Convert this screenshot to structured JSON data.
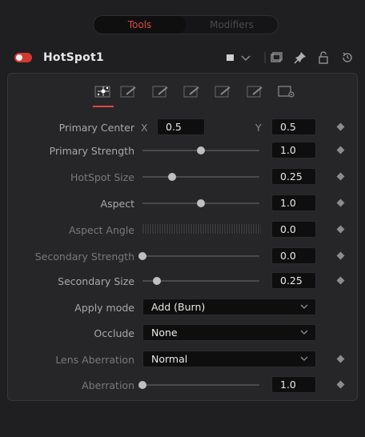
{
  "tabs": {
    "tools": "Tools",
    "modifiers": "Modifiers"
  },
  "tool": {
    "name": "HotSpot1"
  },
  "header_icons": [
    "color-swatch-icon",
    "chevron-down-icon",
    "window-icon",
    "pin-icon",
    "lock-icon",
    "reset-icon"
  ],
  "controls": {
    "primary_center": {
      "label": "Primary Center",
      "x_label": "X",
      "x_value": "0.5",
      "y_label": "Y",
      "y_value": "0.5"
    },
    "primary_strength": {
      "label": "Primary Strength",
      "value": "1.0",
      "slider_fraction": 0.5
    },
    "hotspot_size": {
      "label": "HotSpot Size",
      "value": "0.25",
      "slider_fraction": 0.25
    },
    "aspect": {
      "label": "Aspect",
      "value": "1.0",
      "slider_fraction": 0.5
    },
    "aspect_angle": {
      "label": "Aspect Angle",
      "value": "0.0"
    },
    "secondary_strength": {
      "label": "Secondary Strength",
      "value": "0.0",
      "slider_fraction": 0.0
    },
    "secondary_size": {
      "label": "Secondary Size",
      "value": "0.25",
      "slider_fraction": 0.12
    },
    "apply_mode": {
      "label": "Apply mode",
      "value": "Add (Burn)"
    },
    "occlude": {
      "label": "Occlude",
      "value": "None"
    },
    "lens_aberration": {
      "label": "Lens Aberration",
      "value": "Normal"
    },
    "aberration": {
      "label": "Aberration",
      "value": "1.0",
      "slider_fraction": 0.0
    }
  },
  "colors": {
    "accent": "#e0493e",
    "background": "#1f1f21",
    "panel": "#262628"
  }
}
